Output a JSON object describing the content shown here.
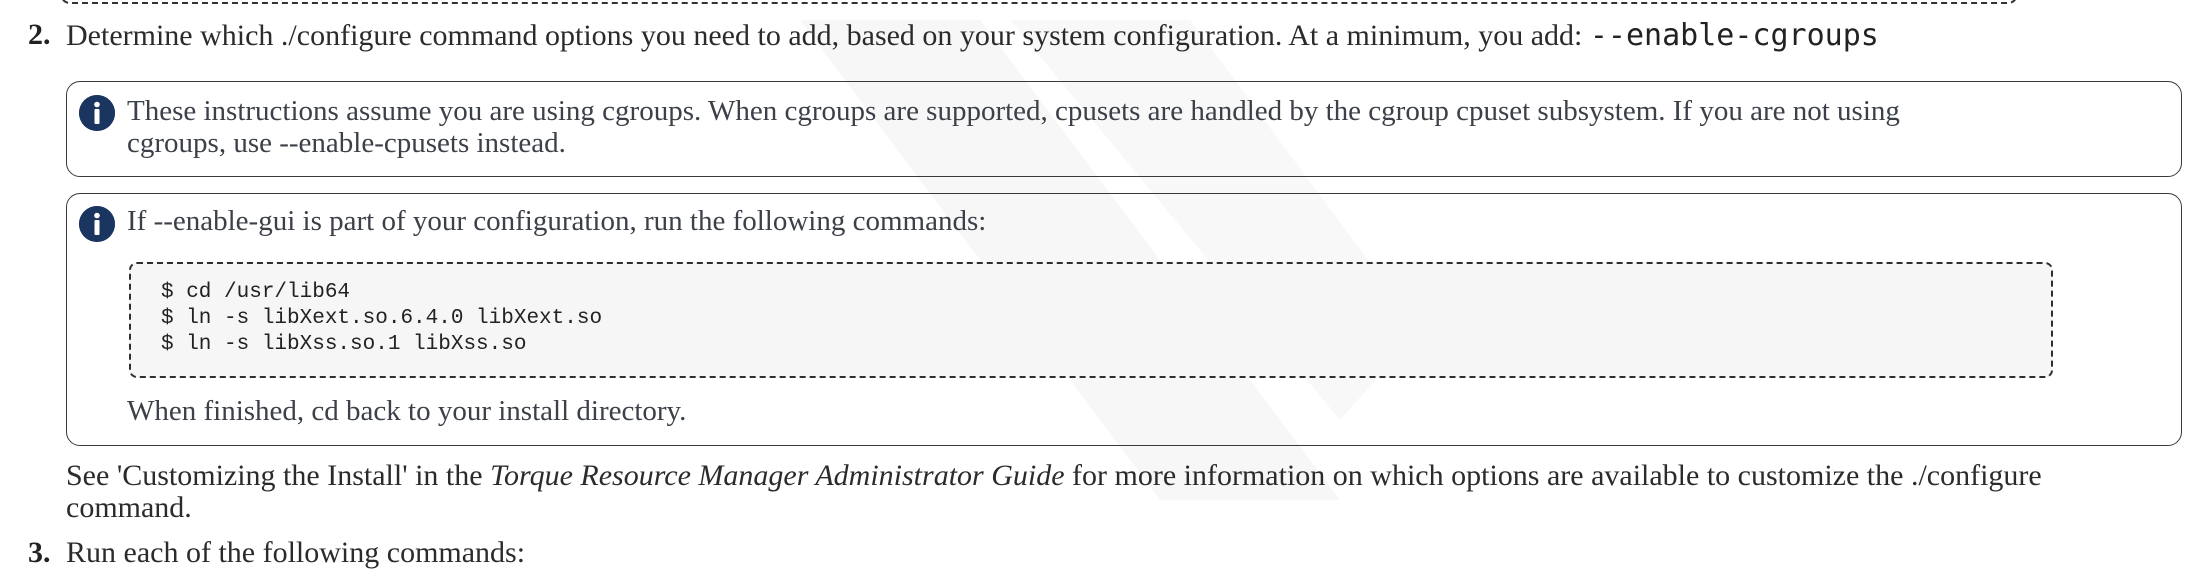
{
  "step2": {
    "number": "2.",
    "text": "Determine which ./configure command options you need to add, based on your system configuration. At a minimum, you add: ",
    "code": "--enable-cgroups"
  },
  "note1": {
    "icon": "info-icon",
    "line1": "These instructions assume you are using cgroups. When cgroups are supported, cpusets are handled by the cgroup cpuset subsystem. If you are not using",
    "line2": "cgroups, use --enable-cpusets instead."
  },
  "note2": {
    "icon": "info-icon",
    "intro": "If --enable-gui is part of your configuration, run the following commands:",
    "code_lines": [
      "$ cd /usr/lib64",
      "$ ln -s libXext.so.6.4.0 libXext.so",
      "$ ln -s libXss.so.1 libXss.so"
    ],
    "outro": "When finished, cd back to your install directory."
  },
  "see_also": {
    "before": "See 'Customizing the Install' in the ",
    "guide": "Torque Resource Manager Administrator Guide",
    "after_line1": " for more information on which options are available to customize the ./configure",
    "line2": "command."
  },
  "step3": {
    "number": "3.",
    "text": "Run each of the following commands:"
  },
  "colors": {
    "icon_fill": "#1a3560",
    "border": "#3a3a3a",
    "code_bg": "#f6f6f6"
  }
}
